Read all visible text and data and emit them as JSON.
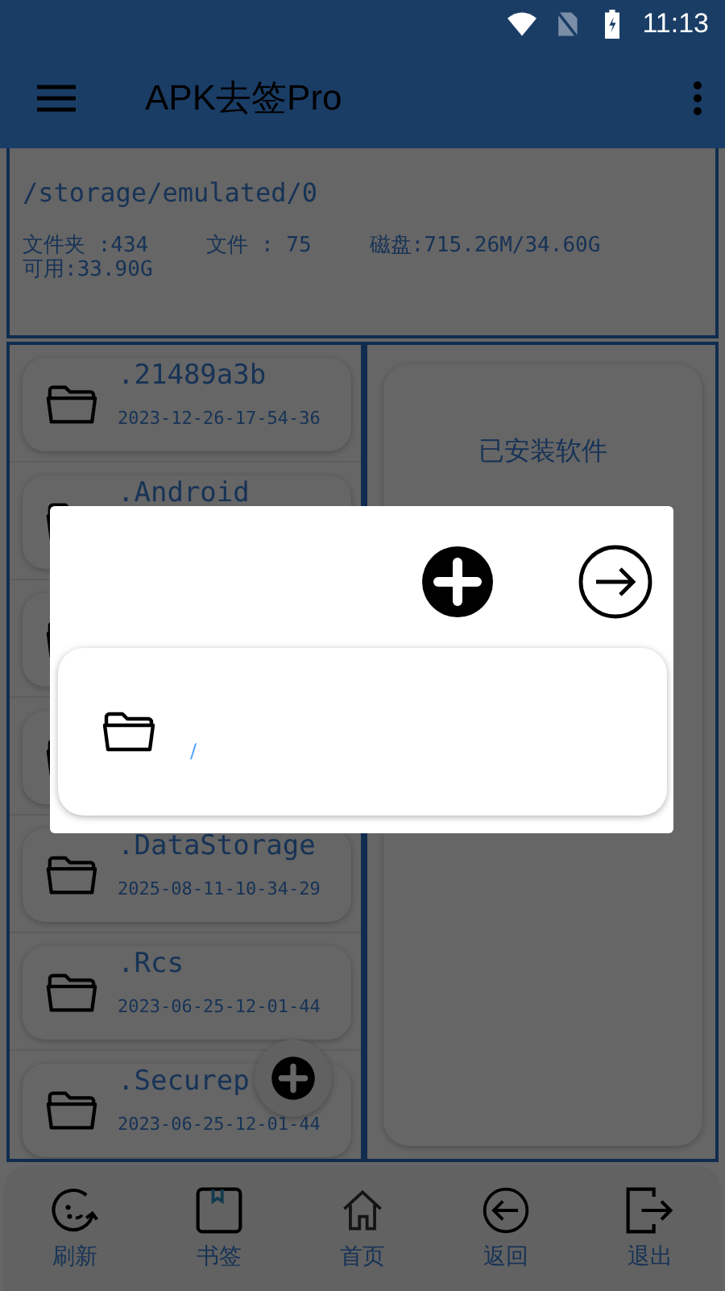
{
  "status_bar": {
    "time": "11:13"
  },
  "app_bar": {
    "title": "APK去签Pro"
  },
  "info": {
    "path": "/storage/emulated/0",
    "stats": [
      "文件夹 :434",
      "文件 : 75",
      "磁盘:715.26M/34.60G",
      "可用:33.90G"
    ]
  },
  "files": [
    {
      "kind": "folder",
      "name": ".21489a3b",
      "date": "2023-12-26-17-54-36"
    },
    {
      "kind": "folder",
      "name": ".Android"
    },
    {
      "kind": "folder"
    },
    {
      "kind": "folder"
    },
    {
      "kind": "folder",
      "name": ".DataStorage",
      "date": "2025-08-11-10-34-29"
    },
    {
      "kind": "folder",
      "name": ".Rcs",
      "date": "2023-06-25-12-01-44"
    },
    {
      "kind": "folder",
      "name": ".Securep",
      "date": "2023-06-25-12-01-44"
    }
  ],
  "installed_panel": {
    "title": "已安装软件"
  },
  "dialog": {
    "entries": [
      {
        "kind": "folder",
        "path": "/"
      }
    ]
  },
  "bottom_nav": [
    {
      "kind": "refresh",
      "label": "刷新"
    },
    {
      "kind": "bookmark",
      "label": "书签"
    },
    {
      "kind": "home",
      "label": "首页"
    },
    {
      "kind": "back",
      "label": "返回"
    },
    {
      "kind": "exit",
      "label": "退出"
    }
  ]
}
